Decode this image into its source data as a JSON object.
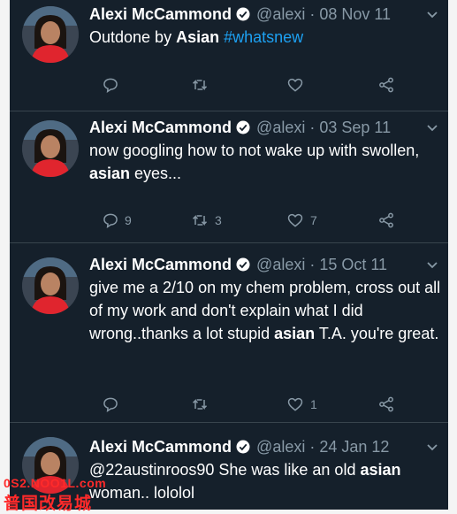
{
  "tweets": [
    {
      "name": "Alexi McCammond",
      "handle": "@alexi",
      "date": "08 Nov 11",
      "text_parts": [
        {
          "t": "Outdone by ",
          "style": "normal"
        },
        {
          "t": "Asian",
          "style": "bold"
        },
        {
          "t": " ",
          "style": "normal"
        },
        {
          "t": "#whatsnew",
          "style": "link"
        }
      ],
      "reply_count": "",
      "retweet_count": "",
      "like_count": ""
    },
    {
      "name": "Alexi McCammond",
      "handle": "@alexi",
      "date": "03 Sep 11",
      "text_parts": [
        {
          "t": "now googling how to not wake up with swollen, ",
          "style": "normal"
        },
        {
          "t": "asian",
          "style": "bold"
        },
        {
          "t": " eyes...",
          "style": "normal"
        }
      ],
      "reply_count": "9",
      "retweet_count": "3",
      "like_count": "7"
    },
    {
      "name": "Alexi McCammond",
      "handle": "@alexi",
      "date": "15 Oct 11",
      "text_parts": [
        {
          "t": "give me a 2/10 on my chem problem, cross out all of my work and don't explain what I did wrong..thanks a lot stupid ",
          "style": "normal"
        },
        {
          "t": "asian",
          "style": "bold"
        },
        {
          "t": " T.A. you're great.",
          "style": "normal"
        }
      ],
      "reply_count": "",
      "retweet_count": "",
      "like_count": "1"
    },
    {
      "name": "Alexi McCammond",
      "handle": "@alexi",
      "date": "24 Jan 12",
      "text_parts": [
        {
          "t": "@22austinroos90 She was like an old ",
          "style": "normal"
        },
        {
          "t": "asian",
          "style": "bold"
        },
        {
          "t": " woman.. lololol",
          "style": "normal"
        }
      ],
      "reply_count": "",
      "retweet_count": "",
      "like_count": ""
    }
  ],
  "watermark": {
    "line1": "0S2.NOO1L.com",
    "line2": "普国改易城"
  },
  "colors": {
    "background": "#15202b",
    "text": "#ffffff",
    "muted": "#8899a6",
    "link": "#1da1f2",
    "verified": "#ffffff",
    "divider": "#38444d",
    "watermark": "#ff2a2a"
  },
  "icons": [
    "reply-icon",
    "retweet-icon",
    "like-icon",
    "share-icon",
    "verified-badge-icon",
    "chevron-down-icon"
  ]
}
